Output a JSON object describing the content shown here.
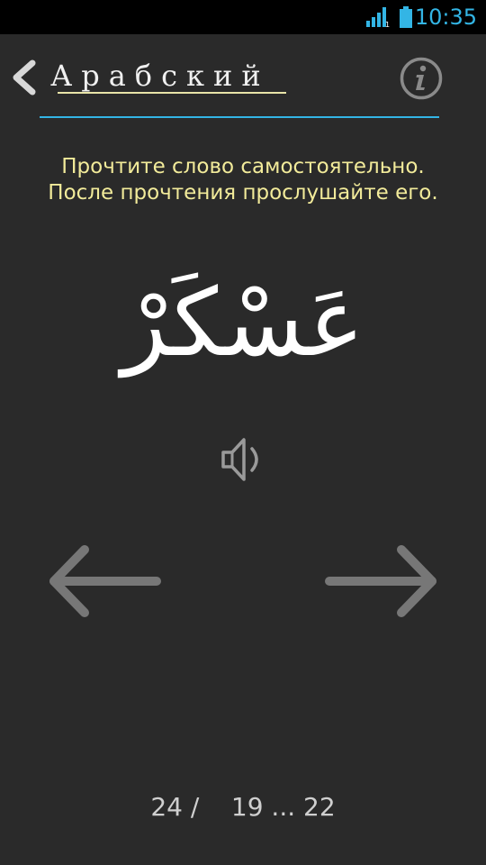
{
  "status_bar": {
    "time": "10:35",
    "signal_icon": "signal-icon",
    "battery_icon": "battery-icon",
    "accent_color": "#33b5e5"
  },
  "header": {
    "back_icon": "chevron-left-icon",
    "title": "Арабский",
    "info_icon": "info-icon"
  },
  "instruction": {
    "line1": "Прочтите слово самостоятельно.",
    "line2": "После прочтения прослушайте его."
  },
  "word": {
    "arabic": "عَسْكَرْ"
  },
  "controls": {
    "sound_icon": "speaker-icon",
    "prev_icon": "arrow-left-icon",
    "next_icon": "arrow-right-icon"
  },
  "pager": {
    "current": "24 /",
    "range": "19 ... 22"
  },
  "colors": {
    "background": "#2a2a2a",
    "instruction_text": "#f2eb9a",
    "divider": "#33b5e5"
  }
}
